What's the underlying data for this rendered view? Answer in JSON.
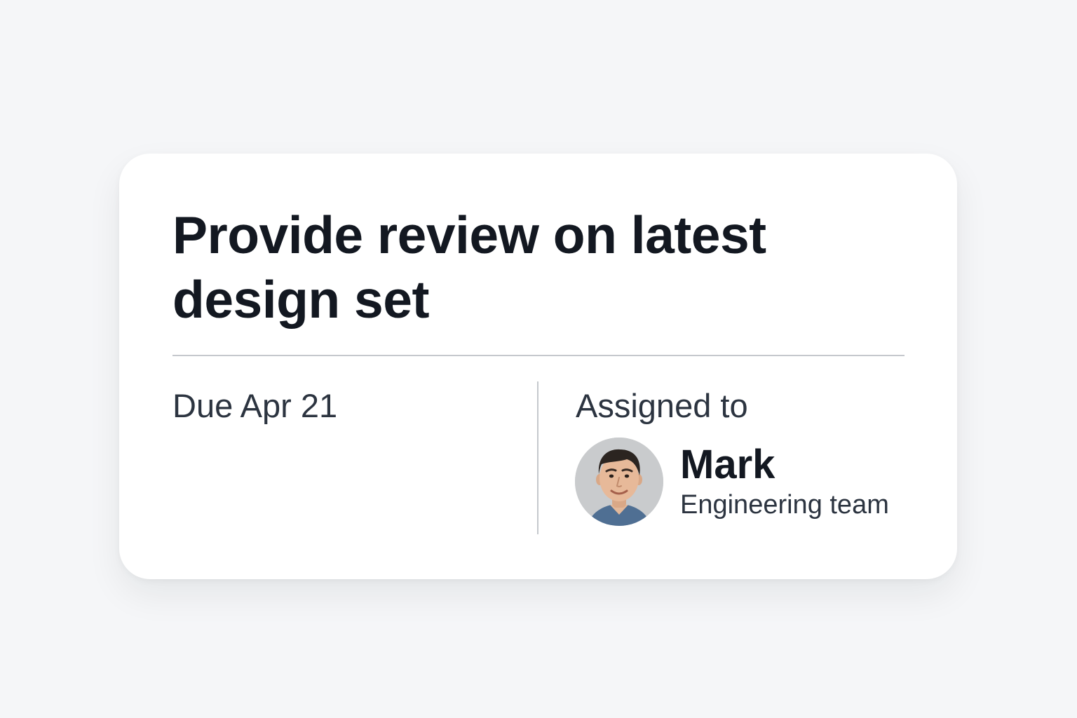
{
  "task": {
    "title": "Provide review on latest design set",
    "due": "Due Apr 21",
    "assigned_label": "Assigned to",
    "assignee": {
      "name": "Mark",
      "team": "Engineering team"
    }
  },
  "colors": {
    "background": "#f5f6f8",
    "card": "#ffffff",
    "title_text": "#131821",
    "body_text": "#2c3440",
    "divider": "#c5c8cd",
    "avatar_bg": "#c9cbcd"
  },
  "icons": {
    "avatar": "user-photo"
  }
}
